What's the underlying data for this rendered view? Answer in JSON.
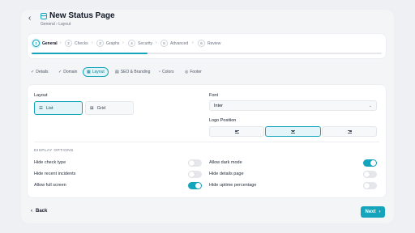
{
  "header": {
    "back_glyph": "‹",
    "title": "New Status Page",
    "breadcrumb": "General › Layout"
  },
  "stepper": {
    "progress_percent": 33,
    "steps": [
      {
        "num": "1",
        "label": "General",
        "active": true
      },
      {
        "num": "2",
        "label": "Checks"
      },
      {
        "num": "3",
        "label": "Graphs"
      },
      {
        "num": "4",
        "label": "Security"
      },
      {
        "num": "5",
        "label": "Advanced"
      },
      {
        "num": "6",
        "label": "Review"
      }
    ],
    "separator": "›"
  },
  "tabs": [
    {
      "icon": "check-icon",
      "glyph": "✓",
      "label": "Details"
    },
    {
      "icon": "check-icon",
      "glyph": "✓",
      "label": "Domain"
    },
    {
      "icon": "layout-icon",
      "glyph": "▦",
      "label": "Layout",
      "active": true
    },
    {
      "icon": "seo-icon",
      "glyph": "▤",
      "label": "SEO & Branding"
    },
    {
      "icon": "palette-icon",
      "glyph": "◔",
      "label": "Colors"
    },
    {
      "icon": "footer-icon",
      "glyph": "◎",
      "label": "Footer"
    }
  ],
  "layout_section": {
    "label": "Layout",
    "options": [
      {
        "label": "List",
        "icon": "list-icon",
        "glyph": "☰",
        "active": true
      },
      {
        "label": "Grid",
        "icon": "grid-icon",
        "glyph": "⊞"
      }
    ]
  },
  "font_section": {
    "label": "Font",
    "value": "Inter",
    "chevron": "⌄"
  },
  "logo_position": {
    "label": "Logo Position",
    "options": [
      "left",
      "center",
      "right"
    ],
    "selected": "center"
  },
  "display_options": {
    "heading": "DISPLAY OPTIONS",
    "left": [
      {
        "label": "Hide check type",
        "on": false
      },
      {
        "label": "Hide recent incidents",
        "on": false
      },
      {
        "label": "Allow full screen",
        "on": true
      }
    ],
    "right": [
      {
        "label": "Allow dark mode",
        "on": true
      },
      {
        "label": "Hide details page",
        "on": false
      },
      {
        "label": "Hide uptime percentage",
        "on": false
      }
    ]
  },
  "footer": {
    "back_label": "Back",
    "back_glyph": "‹",
    "next_label": "Next",
    "next_glyph": "›"
  },
  "colors": {
    "accent": "#14a5bd",
    "accent_soft": "#e3f5f8"
  }
}
